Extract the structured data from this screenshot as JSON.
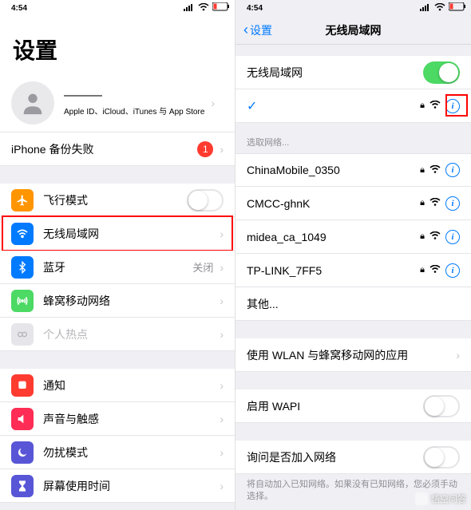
{
  "status": {
    "time": "4:54"
  },
  "left": {
    "title": "设置",
    "profile": {
      "name_obscured": "———",
      "subtitle": "Apple ID、iCloud、iTunes 与 App Store"
    },
    "backup": {
      "label": "iPhone 备份失败",
      "badge": "1"
    },
    "rows1": {
      "airplane": {
        "label": "飞行模式"
      },
      "wifi": {
        "label": "无线局域网"
      },
      "bt": {
        "label": "蓝牙",
        "value": "关闭"
      },
      "cellular": {
        "label": "蜂窝移动网络"
      },
      "hotspot": {
        "label": "个人热点"
      }
    },
    "rows2": {
      "notif": {
        "label": "通知"
      },
      "sound": {
        "label": "声音与触感"
      },
      "dnd": {
        "label": "勿扰模式"
      },
      "screen": {
        "label": "屏幕使用时间"
      }
    }
  },
  "right": {
    "back": "设置",
    "title": "无线局域网",
    "toggleLabel": "无线局域网",
    "choose": "选取网络...",
    "nets": [
      {
        "name": "ChinaMobile_0350"
      },
      {
        "name": "CMCC-ghnK"
      },
      {
        "name": "midea_ca_1049"
      },
      {
        "name": "TP-LINK_7FF5"
      }
    ],
    "other": "其他...",
    "apps": "使用 WLAN 与蜂窝移动网的应用",
    "wapi": "启用 WAPI",
    "ask": "询问是否加入网络",
    "askFooter": "将自动加入已知网络。如果没有已知网络，您必须手动选择。"
  },
  "watermark": "悟空问答",
  "colors": {
    "airplane": "#ff9500",
    "wifi": "#007aff",
    "bt": "#007aff",
    "cellular": "#4cd964",
    "hotspot": "#c7c7cc",
    "notif": "#ff3b30",
    "sound": "#ff2d55",
    "dnd": "#5856d6",
    "screen": "#5856d6"
  }
}
